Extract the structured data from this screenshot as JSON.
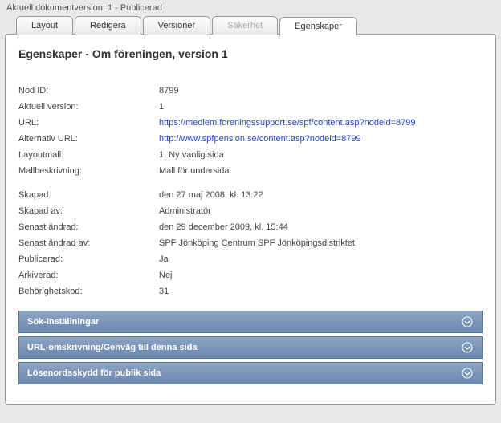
{
  "status": "Aktuell dokumentversion: 1 - Publicerad",
  "tabs": {
    "layout": "Layout",
    "redigera": "Redigera",
    "versioner": "Versioner",
    "sakerhet": "Säkerhet",
    "egenskaper": "Egenskaper"
  },
  "heading": "Egenskaper - Om föreningen, version 1",
  "props": {
    "nodid_label": "Nod ID:",
    "nodid_value": "8799",
    "aktuell_label": "Aktuell version:",
    "aktuell_value": "1",
    "url_label": "URL:",
    "url_value": "https://medlem.foreningssupport.se/spf/content.asp?nodeid=8799",
    "alturl_label": "Alternativ URL:",
    "alturl_value": "http://www.spfpension.se/content.asp?nodeid=8799",
    "layoutmall_label": "Layoutmall:",
    "layoutmall_value": "1. Ny vanlig sida",
    "mallbesk_label": "Mallbeskrivning:",
    "mallbesk_value": "Mall för undersida",
    "skapad_label": "Skapad:",
    "skapad_value": "den 27 maj 2008, kl. 13:22",
    "skapadav_label": "Skapad av:",
    "skapadav_value": "Administratör",
    "senast_label": "Senast ändrad:",
    "senast_value": "den 29 december 2009, kl. 15:44",
    "senastav_label": "Senast ändrad av:",
    "senastav_value": "SPF Jönköping Centrum SPF Jönköpingsdistriktet",
    "publicerad_label": "Publicerad:",
    "publicerad_value": "Ja",
    "arkiverad_label": "Arkiverad:",
    "arkiverad_value": "Nej",
    "behorig_label": "Behörighetskod:",
    "behorig_value": "31"
  },
  "accordion": {
    "sok": "Sök-inställningar",
    "url": "URL-omskrivning/Genväg till denna sida",
    "losen": "Lösenordsskydd för publik sida"
  }
}
